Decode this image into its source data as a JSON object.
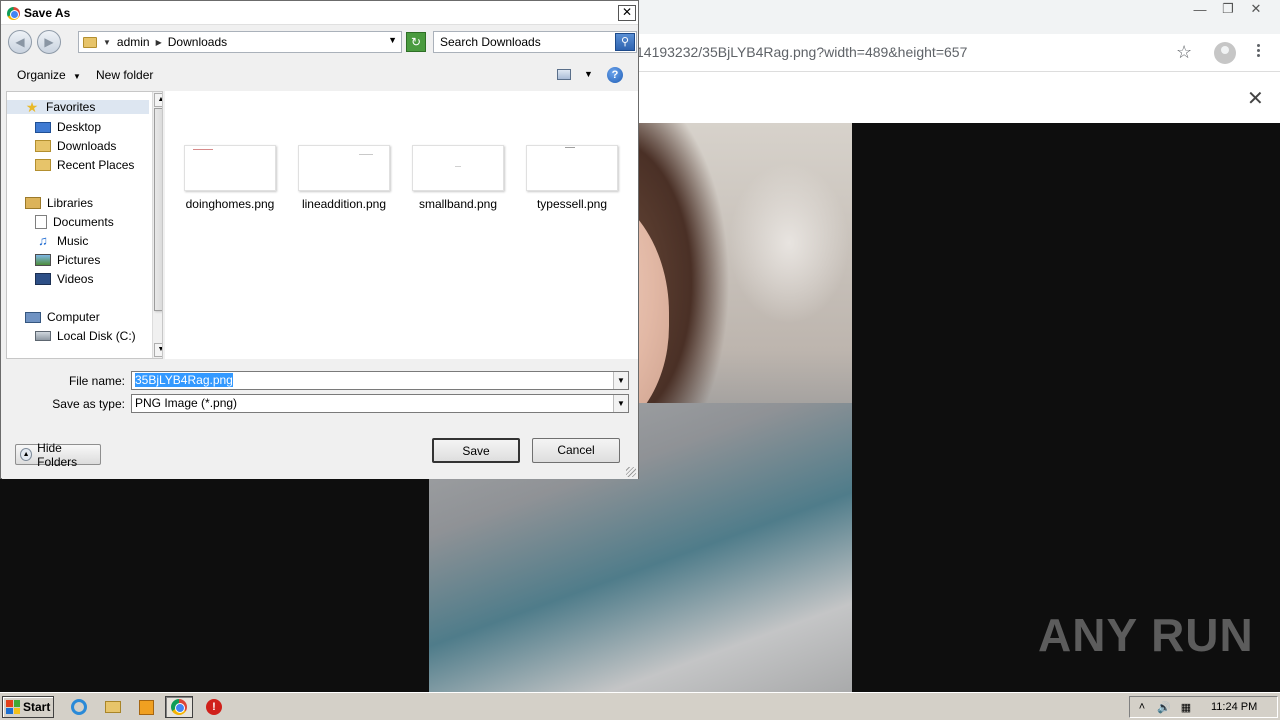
{
  "browser": {
    "url": "14193232/35BjLYB4Rag.png?width=489&height=657",
    "watermark": "ANY RUN"
  },
  "dialog": {
    "title": "Save As",
    "breadcrumb": [
      "admin",
      "Downloads"
    ],
    "search_placeholder": "Search Downloads",
    "toolbar": {
      "organize": "Organize",
      "new_folder": "New folder"
    },
    "nav": {
      "favorites": "Favorites",
      "desktop": "Desktop",
      "downloads": "Downloads",
      "recent_places": "Recent Places",
      "libraries": "Libraries",
      "documents": "Documents",
      "music": "Music",
      "pictures": "Pictures",
      "videos": "Videos",
      "computer": "Computer",
      "local_disk": "Local Disk (C:)"
    },
    "files": [
      "doinghomes.png",
      "lineaddition.png",
      "smallband.png",
      "typessell.png"
    ],
    "file_name_label": "File name:",
    "file_name_value": "35BjLYB4Rag.png",
    "save_type_label": "Save as type:",
    "save_type_value": "PNG Image (*.png)",
    "hide_folders": "Hide Folders",
    "save_button": "Save",
    "cancel_button": "Cancel"
  },
  "taskbar": {
    "start": "Start",
    "clock": "11:24 PM"
  }
}
